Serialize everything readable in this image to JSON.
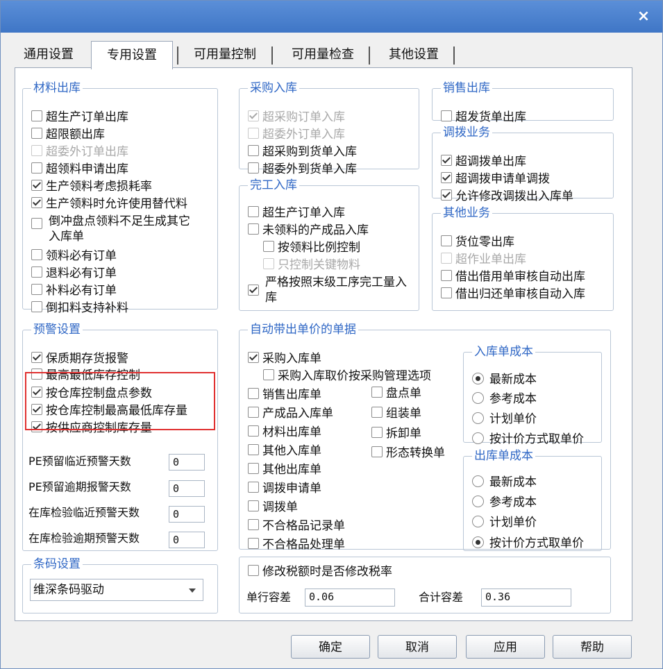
{
  "window": {
    "close_label": "×"
  },
  "tabs": [
    {
      "label": "通用设置"
    },
    {
      "label": "专用设置"
    },
    {
      "label": "可用量控制"
    },
    {
      "label": "可用量检查"
    },
    {
      "label": "其他设置"
    }
  ],
  "material_out": {
    "title": "材料出库",
    "items": [
      {
        "label": "超生产订单出库",
        "checked": false,
        "disabled": false
      },
      {
        "label": "超限额出库",
        "checked": false,
        "disabled": false
      },
      {
        "label": "超委外订单出库",
        "checked": false,
        "disabled": true
      },
      {
        "label": "超领料申请出库",
        "checked": false,
        "disabled": false
      },
      {
        "label": "生产领料考虑损耗率",
        "checked": true,
        "disabled": false
      },
      {
        "label": "生产领料时允许使用替代料",
        "checked": true,
        "disabled": false
      },
      {
        "label": "倒冲盘点领料不足生成其它入库单",
        "checked": false,
        "disabled": false
      },
      {
        "label": "领料必有订单",
        "checked": false,
        "disabled": false
      },
      {
        "label": "退料必有订单",
        "checked": false,
        "disabled": false
      },
      {
        "label": "补料必有订单",
        "checked": false,
        "disabled": false
      },
      {
        "label": "倒扣料支持补料",
        "checked": false,
        "disabled": false
      }
    ]
  },
  "purchase_in": {
    "title": "采购入库",
    "items": [
      {
        "label": "超采购订单入库",
        "checked": true,
        "disabled": true
      },
      {
        "label": "超委外订单入库",
        "checked": false,
        "disabled": true
      },
      {
        "label": "超采购到货单入库",
        "checked": false,
        "disabled": false
      },
      {
        "label": "超委外到货单入库",
        "checked": false,
        "disabled": false
      }
    ]
  },
  "finished_in": {
    "title": "完工入库",
    "items": [
      {
        "label": "超生产订单入库",
        "checked": false,
        "disabled": false
      },
      {
        "label": "未领料的产成品入库",
        "checked": false,
        "disabled": false
      },
      {
        "label": "按领料比例控制",
        "checked": false,
        "disabled": false
      },
      {
        "label": "只控制关键物料",
        "checked": false,
        "disabled": true
      },
      {
        "label": "严格按照末级工序完工量入库",
        "checked": true,
        "disabled": false
      }
    ]
  },
  "sales_out": {
    "title": "销售出库",
    "items": [
      {
        "label": "超发货单出库",
        "checked": false,
        "disabled": false
      }
    ]
  },
  "transfer": {
    "title": "调拨业务",
    "items": [
      {
        "label": "超调拨单出库",
        "checked": true,
        "disabled": false
      },
      {
        "label": "超调拨申请单调拨",
        "checked": true,
        "disabled": false
      },
      {
        "label": "允许修改调拨出入库单",
        "checked": true,
        "disabled": false
      }
    ]
  },
  "other_biz": {
    "title": "其他业务",
    "items": [
      {
        "label": "货位零出库",
        "checked": false,
        "disabled": false
      },
      {
        "label": "超作业单出库",
        "checked": false,
        "disabled": true
      },
      {
        "label": "借出借用单审核自动出库",
        "checked": false,
        "disabled": false
      },
      {
        "label": "借出归还单审核自动入库",
        "checked": false,
        "disabled": false
      }
    ]
  },
  "warning": {
    "title": "预警设置",
    "items": [
      {
        "label": "保质期存货报警",
        "checked": true,
        "disabled": false
      },
      {
        "label": "最高最低库存控制",
        "checked": false,
        "disabled": false
      },
      {
        "label": "按仓库控制盘点参数",
        "checked": true,
        "disabled": false
      },
      {
        "label": "按仓库控制最高最低库存量",
        "checked": true,
        "disabled": false
      },
      {
        "label": "按供应商控制库存量",
        "checked": true,
        "disabled": false
      }
    ],
    "fields": [
      {
        "label": "PE预留临近预警天数",
        "value": "0"
      },
      {
        "label": "PE预留逾期报警天数",
        "value": "0"
      },
      {
        "label": "在库检验临近预警天数",
        "value": "0"
      },
      {
        "label": "在库检验逾期预警天数",
        "value": "0"
      }
    ]
  },
  "barcode": {
    "title": "条码设置",
    "selected": "维深条码驱动"
  },
  "auto_price": {
    "title": "自动带出单价的单据",
    "items": [
      {
        "label": "采购入库单",
        "checked": true,
        "disabled": false
      },
      {
        "label": "采购入库取价按采购管理选项",
        "checked": false,
        "disabled": false
      },
      {
        "label": "销售出库单",
        "checked": false,
        "disabled": false
      },
      {
        "label": "产成品入库单",
        "checked": false,
        "disabled": false
      },
      {
        "label": "材料出库单",
        "checked": false,
        "disabled": false
      },
      {
        "label": "其他入库单",
        "checked": false,
        "disabled": false
      },
      {
        "label": "其他出库单",
        "checked": false,
        "disabled": false
      },
      {
        "label": "调拨申请单",
        "checked": false,
        "disabled": false
      },
      {
        "label": "调拨单",
        "checked": false,
        "disabled": false
      },
      {
        "label": "不合格品记录单",
        "checked": false,
        "disabled": false
      },
      {
        "label": "不合格品处理单",
        "checked": false,
        "disabled": false
      },
      {
        "label": "盘点单",
        "checked": false,
        "disabled": false
      },
      {
        "label": "组装单",
        "checked": false,
        "disabled": false
      },
      {
        "label": "拆卸单",
        "checked": false,
        "disabled": false
      },
      {
        "label": "形态转换单",
        "checked": false,
        "disabled": false
      }
    ]
  },
  "in_cost": {
    "title": "入库单成本",
    "options": [
      {
        "label": "最新成本",
        "selected": true
      },
      {
        "label": "参考成本",
        "selected": false
      },
      {
        "label": "计划单价",
        "selected": false
      },
      {
        "label": "按计价方式取单价",
        "selected": false
      }
    ]
  },
  "out_cost": {
    "title": "出库单成本",
    "options": [
      {
        "label": "最新成本",
        "selected": false
      },
      {
        "label": "参考成本",
        "selected": false
      },
      {
        "label": "计划单价",
        "selected": false
      },
      {
        "label": "按计价方式取单价",
        "selected": true
      }
    ]
  },
  "tax": {
    "modify_label": "修改税额时是否修改税率",
    "modify_checked": false,
    "row_tolerance_label": "单行容差",
    "row_tolerance_value": "0.06",
    "total_tolerance_label": "合计容差",
    "total_tolerance_value": "0.36"
  },
  "buttons": {
    "ok": "确定",
    "cancel": "取消",
    "apply": "应用",
    "help": "帮助"
  }
}
